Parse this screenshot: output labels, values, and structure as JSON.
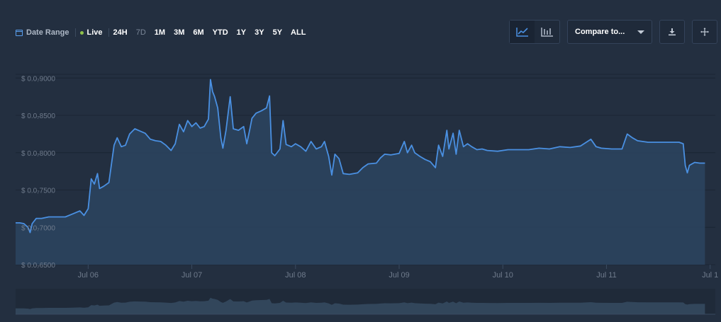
{
  "toolbar": {
    "date_range_label": "Date Range",
    "live_label": "Live",
    "ranges": [
      {
        "label": "24H",
        "active": false
      },
      {
        "label": "7D",
        "active": true
      },
      {
        "label": "1M",
        "active": false
      },
      {
        "label": "3M",
        "active": false
      },
      {
        "label": "6M",
        "active": false
      },
      {
        "label": "YTD",
        "active": false
      },
      {
        "label": "1Y",
        "active": false
      },
      {
        "label": "3Y",
        "active": false
      },
      {
        "label": "5Y",
        "active": false
      },
      {
        "label": "ALL",
        "active": false
      }
    ],
    "compare_label": "Compare to...",
    "icons": {
      "calendar": "calendar-icon",
      "line_chart": "line-chart-icon",
      "candle_chart": "candlestick-chart-icon",
      "download": "download-icon",
      "fullscreen": "move-icon"
    }
  },
  "colors": {
    "background": "#232f40",
    "line": "#4a90e2",
    "area": "#2c4460",
    "live": "#8fc14a",
    "grid": "#1b2533",
    "axis_text": "#6f7b8c"
  },
  "chart_data": {
    "type": "area",
    "title": "",
    "xlabel": "",
    "ylabel": "",
    "x_ticks": [
      "Jul 06",
      "Jul 07",
      "Jul 08",
      "Jul 09",
      "Jul 10",
      "Jul 11",
      "Jul 1"
    ],
    "y_ticks": [
      "$ 0.0₇6500",
      "$ 0.0₇7000",
      "$ 0.0₇7500",
      "$ 0.0₇8000",
      "$ 0.0₇8500",
      "$ 0.0₇9000"
    ],
    "ylim": [
      6.5e-08,
      9.05e-08
    ],
    "xlim_days": [
      5.3,
      12.05
    ],
    "x_unit": "day of July (fractional)",
    "grid": true,
    "legend": "none",
    "series": [
      {
        "points": [
          [
            5.3,
            7.06e-08
          ],
          [
            5.34,
            7.06e-08
          ],
          [
            5.38,
            7.05e-08
          ],
          [
            5.42,
            7e-08
          ],
          [
            5.44,
            6.93e-08
          ],
          [
            5.46,
            7.05e-08
          ],
          [
            5.5,
            7.12e-08
          ],
          [
            5.55,
            7.12e-08
          ],
          [
            5.62,
            7.14e-08
          ],
          [
            5.7,
            7.14e-08
          ],
          [
            5.78,
            7.14e-08
          ],
          [
            5.85,
            7.18e-08
          ],
          [
            5.92,
            7.22e-08
          ],
          [
            5.96,
            7.16e-08
          ],
          [
            6.0,
            7.25e-08
          ],
          [
            6.03,
            7.65e-08
          ],
          [
            6.06,
            7.58e-08
          ],
          [
            6.09,
            7.72e-08
          ],
          [
            6.11,
            7.52e-08
          ],
          [
            6.15,
            7.55e-08
          ],
          [
            6.2,
            7.6e-08
          ],
          [
            6.25,
            8.1e-08
          ],
          [
            6.28,
            8.2e-08
          ],
          [
            6.32,
            8.08e-08
          ],
          [
            6.36,
            8.1e-08
          ],
          [
            6.4,
            8.25e-08
          ],
          [
            6.45,
            8.32e-08
          ],
          [
            6.5,
            8.29e-08
          ],
          [
            6.55,
            8.26e-08
          ],
          [
            6.6,
            8.18e-08
          ],
          [
            6.65,
            8.16e-08
          ],
          [
            6.7,
            8.15e-08
          ],
          [
            6.75,
            8.1e-08
          ],
          [
            6.8,
            8.03e-08
          ],
          [
            6.84,
            8.12e-08
          ],
          [
            6.88,
            8.38e-08
          ],
          [
            6.92,
            8.28e-08
          ],
          [
            6.96,
            8.43e-08
          ],
          [
            7.0,
            8.35e-08
          ],
          [
            7.04,
            8.4e-08
          ],
          [
            7.08,
            8.33e-08
          ],
          [
            7.12,
            8.35e-08
          ],
          [
            7.16,
            8.45e-08
          ],
          [
            7.18,
            8.98e-08
          ],
          [
            7.2,
            8.82e-08
          ],
          [
            7.22,
            8.75e-08
          ],
          [
            7.25,
            8.6e-08
          ],
          [
            7.28,
            8.2e-08
          ],
          [
            7.3,
            8.06e-08
          ],
          [
            7.33,
            8.3e-08
          ],
          [
            7.37,
            8.75e-08
          ],
          [
            7.4,
            8.32e-08
          ],
          [
            7.45,
            8.3e-08
          ],
          [
            7.5,
            8.35e-08
          ],
          [
            7.53,
            8.12e-08
          ],
          [
            7.56,
            8.32e-08
          ],
          [
            7.58,
            8.46e-08
          ],
          [
            7.62,
            8.53e-08
          ],
          [
            7.67,
            8.56e-08
          ],
          [
            7.72,
            8.6e-08
          ],
          [
            7.75,
            8.76e-08
          ],
          [
            7.77,
            8e-08
          ],
          [
            7.8,
            7.96e-08
          ],
          [
            7.85,
            8.05e-08
          ],
          [
            7.88,
            8.43e-08
          ],
          [
            7.91,
            8.11e-08
          ],
          [
            7.96,
            8.08e-08
          ],
          [
            8.0,
            8.12e-08
          ],
          [
            8.05,
            8.08e-08
          ],
          [
            8.1,
            8.02e-08
          ],
          [
            8.15,
            8.15e-08
          ],
          [
            8.2,
            8.05e-08
          ],
          [
            8.25,
            8.08e-08
          ],
          [
            8.28,
            8.15e-08
          ],
          [
            8.32,
            7.95e-08
          ],
          [
            8.35,
            7.7e-08
          ],
          [
            8.38,
            7.98e-08
          ],
          [
            8.42,
            7.92e-08
          ],
          [
            8.46,
            7.72e-08
          ],
          [
            8.52,
            7.71e-08
          ],
          [
            8.6,
            7.73e-08
          ],
          [
            8.65,
            7.8e-08
          ],
          [
            8.7,
            7.85e-08
          ],
          [
            8.78,
            7.86e-08
          ],
          [
            8.82,
            7.93e-08
          ],
          [
            8.86,
            7.98e-08
          ],
          [
            8.92,
            7.97e-08
          ],
          [
            9.0,
            7.99e-08
          ],
          [
            9.05,
            8.15e-08
          ],
          [
            9.08,
            8e-08
          ],
          [
            9.12,
            8.1e-08
          ],
          [
            9.15,
            8e-08
          ],
          [
            9.2,
            7.95e-08
          ],
          [
            9.25,
            7.91e-08
          ],
          [
            9.3,
            7.88e-08
          ],
          [
            9.35,
            7.8e-08
          ],
          [
            9.38,
            8.1e-08
          ],
          [
            9.42,
            7.95e-08
          ],
          [
            9.46,
            8.3e-08
          ],
          [
            9.48,
            8.05e-08
          ],
          [
            9.52,
            8.26e-08
          ],
          [
            9.55,
            7.98e-08
          ],
          [
            9.58,
            8.3e-08
          ],
          [
            9.62,
            8.08e-08
          ],
          [
            9.66,
            8.12e-08
          ],
          [
            9.7,
            8.08e-08
          ],
          [
            9.75,
            8.04e-08
          ],
          [
            9.8,
            8.05e-08
          ],
          [
            9.85,
            8.03e-08
          ],
          [
            9.95,
            8.02e-08
          ],
          [
            10.05,
            8.04e-08
          ],
          [
            10.15,
            8.04e-08
          ],
          [
            10.25,
            8.04e-08
          ],
          [
            10.35,
            8.06e-08
          ],
          [
            10.45,
            8.05e-08
          ],
          [
            10.55,
            8.08e-08
          ],
          [
            10.65,
            8.07e-08
          ],
          [
            10.75,
            8.09e-08
          ],
          [
            10.85,
            8.18e-08
          ],
          [
            10.9,
            8.08e-08
          ],
          [
            10.95,
            8.06e-08
          ],
          [
            11.05,
            8.05e-08
          ],
          [
            11.15,
            8.05e-08
          ],
          [
            11.2,
            8.25e-08
          ],
          [
            11.25,
            8.2e-08
          ],
          [
            11.3,
            8.16e-08
          ],
          [
            11.4,
            8.14e-08
          ],
          [
            11.5,
            8.14e-08
          ],
          [
            11.6,
            8.14e-08
          ],
          [
            11.7,
            8.14e-08
          ],
          [
            11.74,
            8.12e-08
          ],
          [
            11.76,
            7.83e-08
          ],
          [
            11.78,
            7.73e-08
          ],
          [
            11.8,
            7.83e-08
          ],
          [
            11.85,
            7.87e-08
          ],
          [
            11.9,
            7.86e-08
          ],
          [
            11.95,
            7.86e-08
          ]
        ]
      }
    ]
  }
}
